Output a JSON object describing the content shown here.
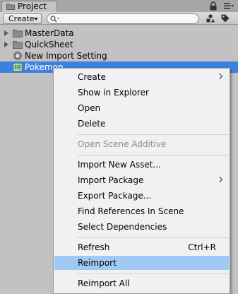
{
  "tab": {
    "title": "Project",
    "icon": "folder-icon"
  },
  "toolbar": {
    "create_label": "Create",
    "search_value": "",
    "icons": [
      "filter-by-type-icon",
      "filter-by-label-icon"
    ]
  },
  "header_icons": [
    "lock-icon",
    "panel-menu-icon"
  ],
  "tree": [
    {
      "label": "MasterData",
      "icon": "folder-icon",
      "expandable": true,
      "selected": false
    },
    {
      "label": "QuickSheet",
      "icon": "folder-icon",
      "expandable": true,
      "selected": false
    },
    {
      "label": "New Import Setting",
      "icon": "script-asset-icon",
      "expandable": false,
      "selected": false
    },
    {
      "label": "Pokemon",
      "icon": "spreadsheet-icon",
      "expandable": false,
      "selected": true
    }
  ],
  "context_menu": {
    "items": [
      {
        "label": "Create",
        "submenu": true
      },
      {
        "label": "Show in Explorer"
      },
      {
        "label": "Open"
      },
      {
        "label": "Delete"
      },
      {
        "label": "Open Scene Additive",
        "disabled": true
      },
      {
        "label": "Import New Asset..."
      },
      {
        "label": "Import Package",
        "submenu": true
      },
      {
        "label": "Export Package..."
      },
      {
        "label": "Find References In Scene"
      },
      {
        "label": "Select Dependencies"
      },
      {
        "label": "Refresh",
        "shortcut": "Ctrl+R"
      },
      {
        "label": "Reimport",
        "highlighted": true
      },
      {
        "label": "Reimport All"
      }
    ]
  },
  "colors": {
    "selection": "#3d80df",
    "menu_highlight": "#9fcaf5",
    "panel_bg": "#c2c2c2"
  }
}
